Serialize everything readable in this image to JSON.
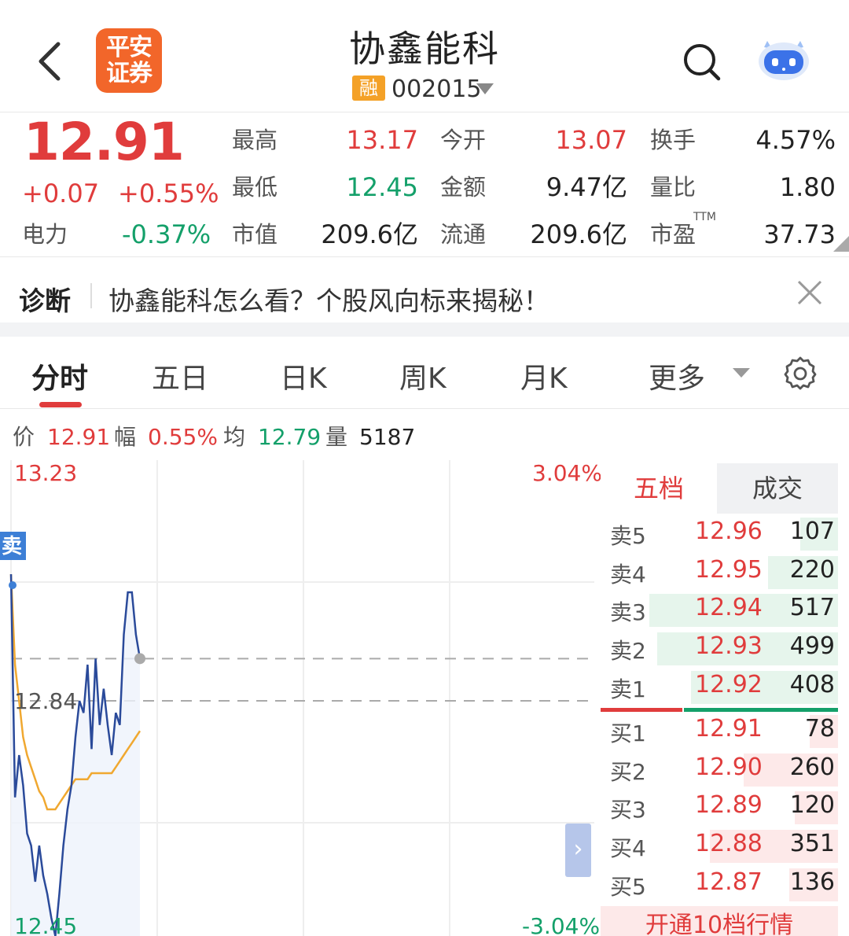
{
  "header": {
    "logo_line1": "平安",
    "logo_line2": "证券",
    "title": "协鑫能科",
    "badge": "融",
    "code": "002015"
  },
  "quote": {
    "price": "12.91",
    "change": "+0.07",
    "change_pct": "+0.55%",
    "sector_label": "电力",
    "sector_pct": "-0.37%",
    "high_label": "最高",
    "high": "13.17",
    "open_label": "今开",
    "open": "13.07",
    "turnover_label": "换手",
    "turnover": "4.57%",
    "low_label": "最低",
    "low": "12.45",
    "amount_label": "金额",
    "amount": "9.47亿",
    "vol_ratio_label": "量比",
    "vol_ratio": "1.80",
    "mcap_label": "市值",
    "mcap": "209.6亿",
    "float_label": "流通",
    "float_cap": "209.6亿",
    "pe_label": "市盈",
    "pe_sup": "TTM",
    "pe": "37.73"
  },
  "diagnosis": {
    "label": "诊断",
    "text": "协鑫能科怎么看？个股风向标来揭秘！"
  },
  "tabs": [
    "分时",
    "五日",
    "日K",
    "周K",
    "月K",
    "更多"
  ],
  "info": {
    "price_label": "价",
    "price": "12.91",
    "range_label": "幅",
    "range": "0.55%",
    "avg_label": "均",
    "avg": "12.79",
    "vol_label": "量",
    "vol": "5187"
  },
  "chart_data": {
    "type": "line",
    "y_top": "13.23",
    "y_mid": "12.84",
    "y_bottom": "12.45",
    "pct_top": "3.04%",
    "pct_bottom": "-3.04%",
    "ylim": [
      12.45,
      13.23
    ],
    "prev_close": 12.84,
    "marker_label": "卖",
    "series": [
      {
        "values": [
          13.05,
          12.68,
          12.75,
          12.7,
          12.62,
          12.6,
          12.54,
          12.6,
          12.55,
          12.52,
          12.48,
          12.45,
          12.52,
          12.6,
          12.66,
          12.7,
          12.78,
          12.84,
          12.82,
          12.9,
          12.76,
          12.91,
          12.8,
          12.86,
          12.8,
          12.75,
          12.82,
          12.8,
          12.95,
          13.02,
          13.02,
          12.95,
          12.91
        ]
      },
      {
        "values": [
          13.05,
          12.9,
          12.84,
          12.78,
          12.75,
          12.73,
          12.71,
          12.69,
          12.68,
          12.66,
          12.66,
          12.66,
          12.67,
          12.68,
          12.69,
          12.7,
          12.71,
          12.71,
          12.71,
          12.71,
          12.72,
          12.72,
          12.72,
          12.72,
          12.72,
          12.72,
          12.73,
          12.74,
          12.75,
          12.76,
          12.77,
          12.78,
          12.79
        ]
      }
    ]
  },
  "orderbook": {
    "tab_five": "五档",
    "tab_trades": "成交",
    "open10": "开通10档行情",
    "expand": "›",
    "asks": [
      {
        "name": "卖5",
        "price": "12.96",
        "vol": "107",
        "depth": 0.2
      },
      {
        "name": "卖4",
        "price": "12.95",
        "vol": "220",
        "depth": 0.37
      },
      {
        "name": "卖3",
        "price": "12.94",
        "vol": "517",
        "depth": 1.0
      },
      {
        "name": "卖2",
        "price": "12.93",
        "vol": "499",
        "depth": 0.96
      },
      {
        "name": "卖1",
        "price": "12.92",
        "vol": "408",
        "depth": 0.78
      }
    ],
    "bids": [
      {
        "name": "买1",
        "price": "12.91",
        "vol": "78",
        "depth": 0.15
      },
      {
        "name": "买2",
        "price": "12.90",
        "vol": "260",
        "depth": 0.5
      },
      {
        "name": "买3",
        "price": "12.89",
        "vol": "120",
        "depth": 0.23
      },
      {
        "name": "买4",
        "price": "12.88",
        "vol": "351",
        "depth": 0.68
      },
      {
        "name": "买5",
        "price": "12.87",
        "vol": "136",
        "depth": 0.26
      }
    ]
  },
  "colors": {
    "up": "#e03c3c",
    "down": "#14a06a",
    "price_line": "#2a4a9a",
    "avg_line": "#f0a830",
    "logo": "#f2662a",
    "ask_bar": "#e6f5ec",
    "bid_bar": "#fde9e9"
  },
  "icons": {
    "back": "chevron-left-icon",
    "search": "search-icon",
    "assistant": "robot-icon",
    "close": "close-icon",
    "settings": "gear-icon"
  }
}
